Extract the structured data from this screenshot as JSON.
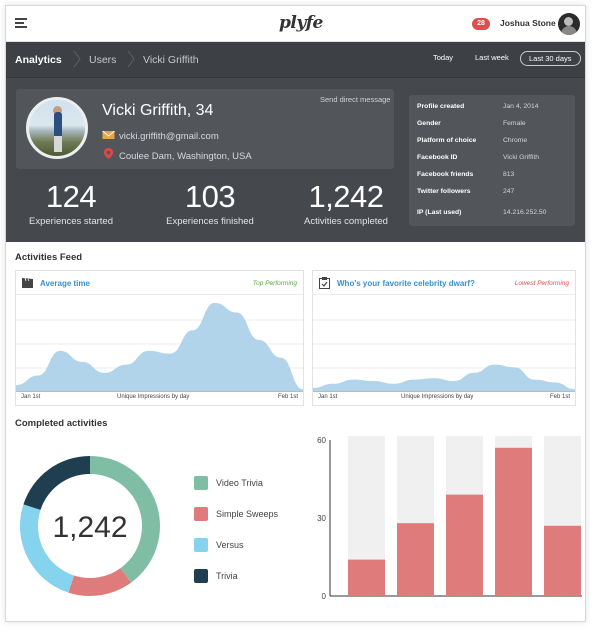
{
  "app": {
    "logo": "plyfe",
    "notification_count": "28",
    "user_name": "Joshua Stone"
  },
  "breadcrumb": {
    "items": [
      "Analytics",
      "Users",
      "Vicki Griffith"
    ]
  },
  "date_range": {
    "options": [
      "Today",
      "Last week",
      "Last 30 days"
    ],
    "selected": "Last 30 days"
  },
  "profile": {
    "name": "Vicki Griffith, 34",
    "email": "vicki.griffith@gmail.com",
    "location": "Coulee Dam, Washington, USA",
    "send_message": "Send direct message"
  },
  "stats": [
    {
      "value": "124",
      "label": "Experiences started"
    },
    {
      "value": "103",
      "label": "Experiences finished"
    },
    {
      "value": "1,242",
      "label": "Activities completed"
    }
  ],
  "details": [
    {
      "key": "Profile created",
      "value": "Jan 4, 2014"
    },
    {
      "key": "Gender",
      "value": "Female"
    },
    {
      "key": "Platform of choice",
      "value": "Chrome"
    },
    {
      "key": "Facebook ID",
      "value": "Vicki Griffith"
    },
    {
      "key": "Facebook friends",
      "value": "813"
    },
    {
      "key": "Twitter followers",
      "value": "247"
    },
    {
      "key": "IP (Last used)",
      "value": "14.216.252.50"
    }
  ],
  "feed": {
    "title": "Activities Feed",
    "cards": [
      {
        "icon": "clapperboard-icon",
        "title": "Average time",
        "tag": "Top Performing",
        "tag_color": "#5aa63f",
        "x_start": "Jan 1st",
        "x_mid": "Unique Impressions by day",
        "x_end": "Feb 1st"
      },
      {
        "icon": "clipboard-check-icon",
        "title": "Who's your favorite celebrity dwarf?",
        "tag": "Lowest Performing",
        "tag_color": "#e05050",
        "x_start": "Jan 1st",
        "x_mid": "Unique Impressions by day",
        "x_end": "Feb 1st"
      }
    ]
  },
  "completed": {
    "title": "Completed activities",
    "total": "1,242",
    "legend": [
      {
        "label": "Video Trivia",
        "color": "#7fbea4"
      },
      {
        "label": "Simple Sweeps",
        "color": "#e07b7b"
      },
      {
        "label": "Versus",
        "color": "#86d3ee"
      },
      {
        "label": "Trivia",
        "color": "#1f3e4f"
      }
    ]
  },
  "chart_data": [
    {
      "type": "area",
      "title": "Average time",
      "xlabel": "Unique Impressions by day",
      "x": [
        "Jan 1st",
        "",
        "",
        "",
        "",
        "",
        "",
        "",
        "",
        "",
        "",
        "",
        "",
        "Feb 1st"
      ],
      "series": [
        {
          "values": [
            5,
            12,
            30,
            22,
            14,
            20,
            30,
            28,
            45,
            65,
            58,
            38,
            25,
            2
          ]
        }
      ],
      "color": "#a9cfe8"
    },
    {
      "type": "area",
      "title": "Who's your favorite celebrity dwarf?",
      "xlabel": "Unique Impressions by day",
      "x": [
        "Jan 1st",
        "",
        "",
        "",
        "",
        "",
        "",
        "",
        "",
        "",
        "",
        "",
        "",
        "Feb 1st"
      ],
      "series": [
        {
          "values": [
            3,
            6,
            9,
            8,
            6,
            9,
            10,
            8,
            14,
            20,
            18,
            9,
            7,
            2
          ]
        }
      ],
      "color": "#a9cfe8"
    },
    {
      "type": "pie",
      "donut": true,
      "categories": [
        "Video Trivia",
        "Simple Sweeps",
        "Versus",
        "Trivia"
      ],
      "values": [
        40,
        15,
        25,
        20
      ],
      "colors": [
        "#7fbea4",
        "#e07b7b",
        "#86d3ee",
        "#1f3e4f"
      ]
    },
    {
      "type": "bar",
      "categories": [
        "",
        "",
        "",
        "",
        ""
      ],
      "values": [
        14,
        28,
        39,
        57,
        27
      ],
      "background_max": 60,
      "ylim": [
        0,
        60
      ],
      "yticks": [
        "0",
        "30",
        "60"
      ],
      "color": "#e07b7b",
      "track_color": "#f0f0f0"
    }
  ]
}
